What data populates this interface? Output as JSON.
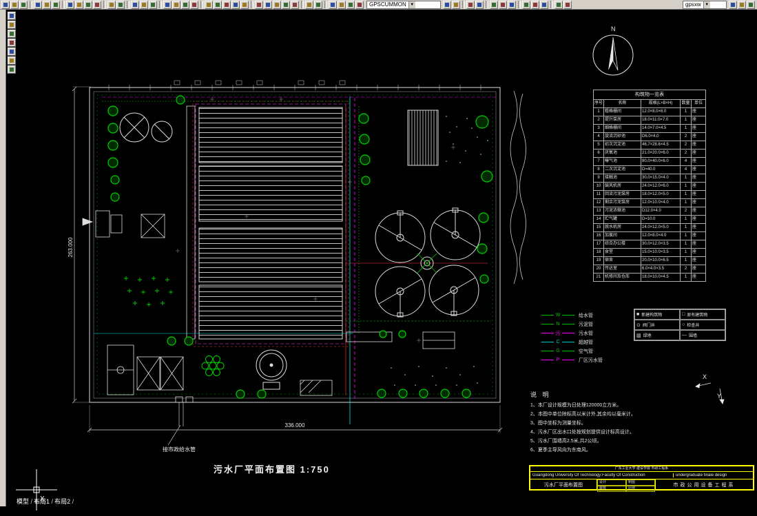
{
  "toolbar": {
    "groups": [
      [
        "new",
        "open",
        "save",
        "|",
        "print",
        "print-preview",
        "spelling",
        "|",
        "cut",
        "copy",
        "paste",
        "match-properties",
        "|",
        "undo",
        "redo",
        "|",
        "insert-block",
        "external-reference",
        "image-attach",
        "|",
        "pan-realtime",
        "zoom-realtime",
        "zoom-window",
        "zoom-previous",
        "|",
        "distance",
        "area-tool",
        "mass-properties",
        "list-tool",
        "locate-point",
        "|",
        "dimension-style",
        "text-style",
        "table-style",
        "point-style",
        "units",
        "|",
        "named-views",
        "3d-orbit",
        "|",
        "layers",
        "layer-states",
        "make-object-layer-current",
        "layer-previous"
      ],
      [
        "layer-control-lock",
        "color-control",
        "|",
        "linetype-manager",
        "lineweight-settings",
        "|",
        "properties-palette",
        "design-center",
        "tool-palettes",
        "|",
        "sheet-set-manager",
        "markup-set-manager",
        "quickcalc",
        "|",
        "block-editor",
        "xref-palette"
      ],
      [
        "render-tool",
        "workspace-switch",
        "clean-screen"
      ]
    ],
    "layer_combo_value": "GPSCUMMON",
    "style_combo_value": "gpsxw",
    "combo_arrow": "▼"
  },
  "side_toolbar": {
    "icons": [
      "select",
      "zoom-in",
      "zoom-out",
      "pan-hand",
      "orbit",
      "measure-tool",
      "layers-side"
    ]
  },
  "tabs": {
    "items": [
      "模型",
      "布局1",
      "布局2"
    ]
  },
  "drawing": {
    "title": "污水厂平面布置图  1:750",
    "bottom_dimension": "336.000",
    "left_dimension": "263.000",
    "water_main_label": "接市政给水管",
    "north_label": "N",
    "axis_x": "X",
    "axis_y": "Y",
    "crosshair_label": "X"
  },
  "table": {
    "title": "构筑物一览表",
    "headers": [
      "序号",
      "名称",
      "规格(L×B×H)",
      "数量",
      "单位"
    ],
    "rows": [
      [
        "1",
        "粗格栅间",
        "12.0×8.0×6.0",
        "1",
        "座"
      ],
      [
        "2",
        "提升泵房",
        "18.0×11.0×7.0",
        "1",
        "座"
      ],
      [
        "3",
        "细格栅间",
        "14.0×7.0×4.5",
        "1",
        "座"
      ],
      [
        "4",
        "旋流沉砂池",
        "D6.0×4.0",
        "2",
        "座"
      ],
      [
        "5",
        "初次沉淀池",
        "46.7×28.6×4.5",
        "2",
        "座"
      ],
      [
        "6",
        "厌氧池",
        "21.0×20.0×6.0",
        "2",
        "座"
      ],
      [
        "7",
        "曝气池",
        "80.0×40.0×6.0",
        "4",
        "座"
      ],
      [
        "8",
        "二次沉淀池",
        "D=40.0",
        "4",
        "座"
      ],
      [
        "9",
        "接触池",
        "30.0×15.0×4.0",
        "1",
        "座"
      ],
      [
        "10",
        "鼓风机房",
        "24.0×12.0×6.0",
        "1",
        "座"
      ],
      [
        "11",
        "回流污泥泵房",
        "18.0×12.0×5.0",
        "1",
        "座"
      ],
      [
        "12",
        "剩余污泥泵房",
        "12.0×10.0×4.0",
        "1",
        "座"
      ],
      [
        "13",
        "污泥浓缩池",
        "D12.0×4.0",
        "2",
        "座"
      ],
      [
        "14",
        "贮气罐",
        "D=10.0",
        "1",
        "座"
      ],
      [
        "15",
        "脱水机房",
        "24.0×12.0×5.0",
        "1",
        "座"
      ],
      [
        "16",
        "加氯间",
        "12.0×8.0×4.0",
        "1",
        "座"
      ],
      [
        "17",
        "综合办公楼",
        "30.0×12.0×3.5",
        "1",
        "座"
      ],
      [
        "18",
        "食堂",
        "15.0×10.0×3.5",
        "1",
        "座"
      ],
      [
        "19",
        "宿舍",
        "20.0×10.0×6.5",
        "1",
        "座"
      ],
      [
        "20",
        "传达室",
        "6.0×4.0×3.5",
        "2",
        "座"
      ],
      [
        "21",
        "机修间及仓库",
        "18.0×10.0×4.5",
        "1",
        "座"
      ]
    ]
  },
  "legend_pipes": [
    {
      "letter": "W",
      "color": "#00c000",
      "label": "给水管"
    },
    {
      "letter": "N",
      "color": "#00c000",
      "label": "污泥管"
    },
    {
      "letter": "污",
      "color": "#ff00ff",
      "label": "污水管"
    },
    {
      "letter": "C",
      "color": "#00cccc",
      "label": "超越管"
    },
    {
      "letter": "G",
      "color": "#00c000",
      "label": "空气管"
    },
    {
      "letter": "P",
      "color": "#ff00ff",
      "label": "厂区污水管"
    }
  ],
  "legend_symbols": {
    "items": [
      {
        "symbol": "■",
        "label": "新建构筑物"
      },
      {
        "symbol": "□",
        "label": "原有建筑物"
      },
      {
        "symbol": "⊙",
        "label": "阀门井"
      },
      {
        "symbol": "○",
        "label": "检查井"
      },
      {
        "symbol": "▨",
        "label": "绿地"
      },
      {
        "symbol": "—",
        "label": "围墙"
      }
    ]
  },
  "notes": {
    "title": "说 明",
    "lines": [
      "1、本厂设计规模为日处理120000立方米。",
      "2、本图中单位除标高以米计外,其余均以毫米计。",
      "3、图中坐标为测量坐标。",
      "4、污水厂区出水口处按规划提供设计标高设计。",
      "5、污水厂围墙高2.5米,共2公顷。",
      "6、夏季主导风向为东南风。"
    ]
  },
  "title_block": {
    "line1": "广东工业大学 建设学院 市政工程系",
    "university": "Guangdong University Of Technology:Faculty Of Construction",
    "project": "undergraduate finale design",
    "drawing_name": "污水厂平面布置图",
    "department": "市政公用设备工程系",
    "cells": [
      "设计",
      "制图",
      "审核",
      "比例"
    ]
  }
}
